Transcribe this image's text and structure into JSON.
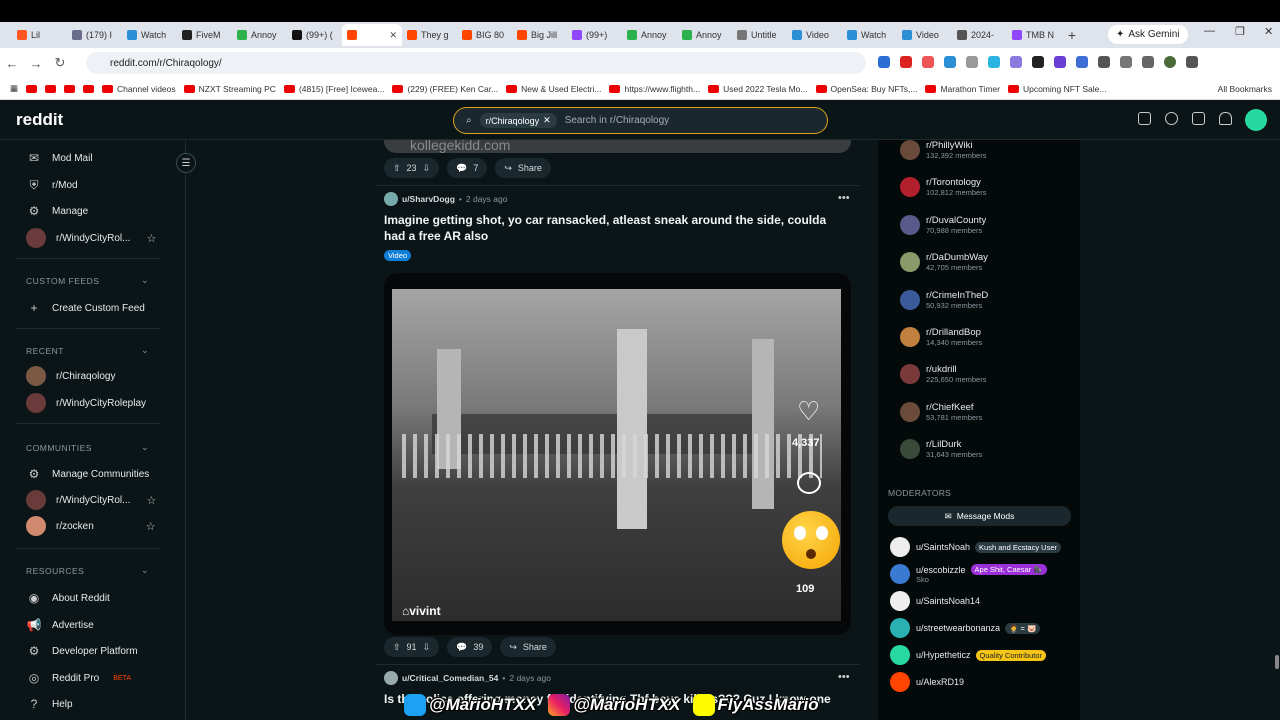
{
  "browser": {
    "tabs": [
      {
        "label": "Lil",
        "color": "#ff5722"
      },
      {
        "label": "(179) I",
        "color": "#6b6b8a"
      },
      {
        "label": "Watch",
        "color": "#2b8fd6"
      },
      {
        "label": "FiveM",
        "color": "#222222"
      },
      {
        "label": "Annoy",
        "color": "#2bb24c"
      },
      {
        "label": "(99+) (",
        "color": "#111111"
      },
      {
        "label": "",
        "color": "#ff4500",
        "active": true
      },
      {
        "label": "They g",
        "color": "#ff4500"
      },
      {
        "label": "BIG 80",
        "color": "#ff4500"
      },
      {
        "label": "Big Jill",
        "color": "#ff4500"
      },
      {
        "label": "(99+)",
        "color": "#9146ff"
      },
      {
        "label": "Annoy",
        "color": "#2bb24c"
      },
      {
        "label": "Annoy",
        "color": "#2bb24c"
      },
      {
        "label": "Untitle",
        "color": "#777777"
      },
      {
        "label": "Video",
        "color": "#2b8fd6"
      },
      {
        "label": "Watch",
        "color": "#2b8fd6"
      },
      {
        "label": "Video",
        "color": "#2b8fd6"
      },
      {
        "label": "2024-",
        "color": "#555555"
      },
      {
        "label": "TMB N",
        "color": "#9146ff"
      }
    ],
    "ask_gemini": "Ask Gemini",
    "url": "reddit.com/r/Chiraqology/",
    "bookmarks": [
      "Channel videos",
      "NZXT Streaming PC",
      "(4815) [Free] Icewea...",
      "(229) (FREE) Ken Car...",
      "New & Used Electri...",
      "https://www.flighth...",
      "Used 2022 Tesla Mo...",
      "OpenSea: Buy NFTs,...",
      "Marathon Timer",
      "Upcoming NFT Sale..."
    ],
    "all_bookmarks": "All Bookmarks"
  },
  "reddit": {
    "logo": "reddit",
    "search_chip": "r/Chiraqology",
    "search_placeholder": "Search in r/Chiraqology",
    "sidebar": {
      "top_items": [
        "Mod Mail",
        "r/Mod",
        "Manage",
        "r/WindyCityRol..."
      ],
      "custom_feeds_header": "CUSTOM FEEDS",
      "create_custom_feed": "Create Custom Feed",
      "recent_header": "RECENT",
      "recent": [
        "r/Chiraqology",
        "r/WindyCityRoleplay"
      ],
      "communities_header": "COMMUNITIES",
      "manage_communities": "Manage Communities",
      "communities": [
        "r/WindyCityRol...",
        "r/zocken"
      ],
      "resources_header": "RESOURCES",
      "resources": [
        "About Reddit",
        "Advertise",
        "Developer Platform",
        "Reddit Pro",
        "Help"
      ],
      "beta": "BETA"
    },
    "feed": {
      "prev_post": {
        "watermark": "kollegekidd.com",
        "upvotes": "23",
        "comments": "7",
        "share": "Share"
      },
      "post": {
        "user": "u/SharvDogg",
        "time": "2 days ago",
        "title": "Imagine getting shot, yo car ransacked, atleast sneak around the side, coulda had a free AR also",
        "flair": "Video",
        "video_brand": "vivint",
        "video_likes": "4,337",
        "video_shares": "109",
        "upvotes": "91",
        "comments": "39",
        "share": "Share"
      },
      "next_post": {
        "user": "u/Critical_Comedian_54",
        "time": "2 days ago",
        "title_partial": "Is the police offering money for identifying Thf boys killers??? Cuz I know one"
      }
    },
    "right": {
      "communities": [
        {
          "name": "r/PhillyWiki",
          "members": "132,392 members"
        },
        {
          "name": "r/Torontology",
          "members": "102,812 members"
        },
        {
          "name": "r/DuvalCounty",
          "members": "70,988 members"
        },
        {
          "name": "r/DaDumbWay",
          "members": "42,705 members"
        },
        {
          "name": "r/CrimeInTheD",
          "members": "50,932 members"
        },
        {
          "name": "r/DrillandBop",
          "members": "14,340 members"
        },
        {
          "name": "r/ukdrill",
          "members": "225,650 members"
        },
        {
          "name": "r/ChiefKeef",
          "members": "53,781 members"
        },
        {
          "name": "r/LilDurk",
          "members": "31,643 members"
        }
      ],
      "moderators_header": "MODERATORS",
      "message_mods": "Message Mods",
      "moderators": [
        {
          "name": "u/SaintsNoah",
          "flair": "Kush and Ecstacy User",
          "flair_color": "#2a3c42"
        },
        {
          "name": "u/escobizzle",
          "flair": "Ape Shit, Caesar 🦍",
          "flair_color": "#9b30d9",
          "sub": "Sko"
        },
        {
          "name": "u/SaintsNoah14",
          "flair": "",
          "flair_color": ""
        },
        {
          "name": "u/streetwearbonanza",
          "flair": "🤵 = 🐷",
          "flair_color": "#2a3c42"
        },
        {
          "name": "u/Hypetheticz",
          "flair": "Quality Contributor",
          "flair_color": "#f5c518"
        },
        {
          "name": "u/AlexRD19",
          "flair": "",
          "flair_color": ""
        }
      ]
    }
  },
  "overlay": {
    "twitter": "@MarioHTXX",
    "instagram": "@MarioHTXX",
    "snapchat": "FlyAssMario"
  }
}
